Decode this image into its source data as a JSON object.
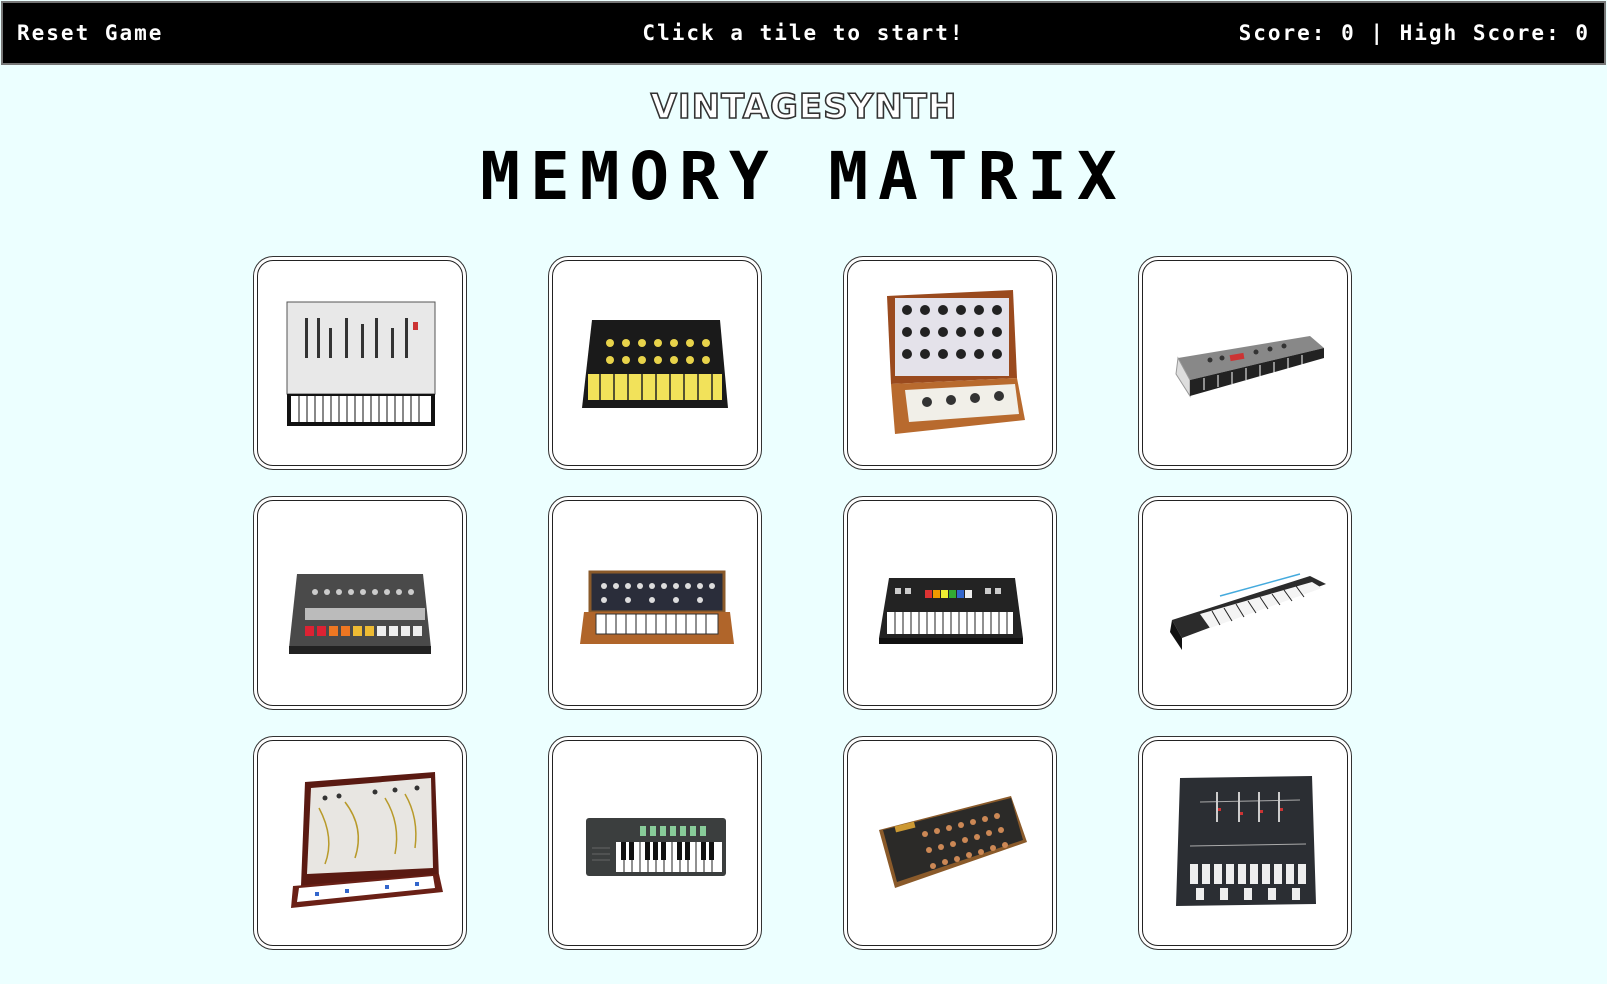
{
  "header": {
    "reset_label": "Reset Game",
    "status": "Click a tile to start!",
    "score_text": "Score: 0 | High Score: 0"
  },
  "logo": {
    "text": "VINTAGESYNTH"
  },
  "title": "MEMORY MATRIX",
  "tiles": [
    {
      "icon": "white-synth-keyboard-icon"
    },
    {
      "icon": "black-yellow-synth-icon"
    },
    {
      "icon": "wood-modular-synth-icon"
    },
    {
      "icon": "silver-angled-synth-icon"
    },
    {
      "icon": "drum-machine-icon"
    },
    {
      "icon": "wood-analog-synth-icon"
    },
    {
      "icon": "black-poly-synth-icon"
    },
    {
      "icon": "black-long-keyboard-icon"
    },
    {
      "icon": "modular-cabinet-icon"
    },
    {
      "icon": "mini-keyboard-icon"
    },
    {
      "icon": "sequencer-module-icon"
    },
    {
      "icon": "black-minisynth-icon"
    }
  ]
}
